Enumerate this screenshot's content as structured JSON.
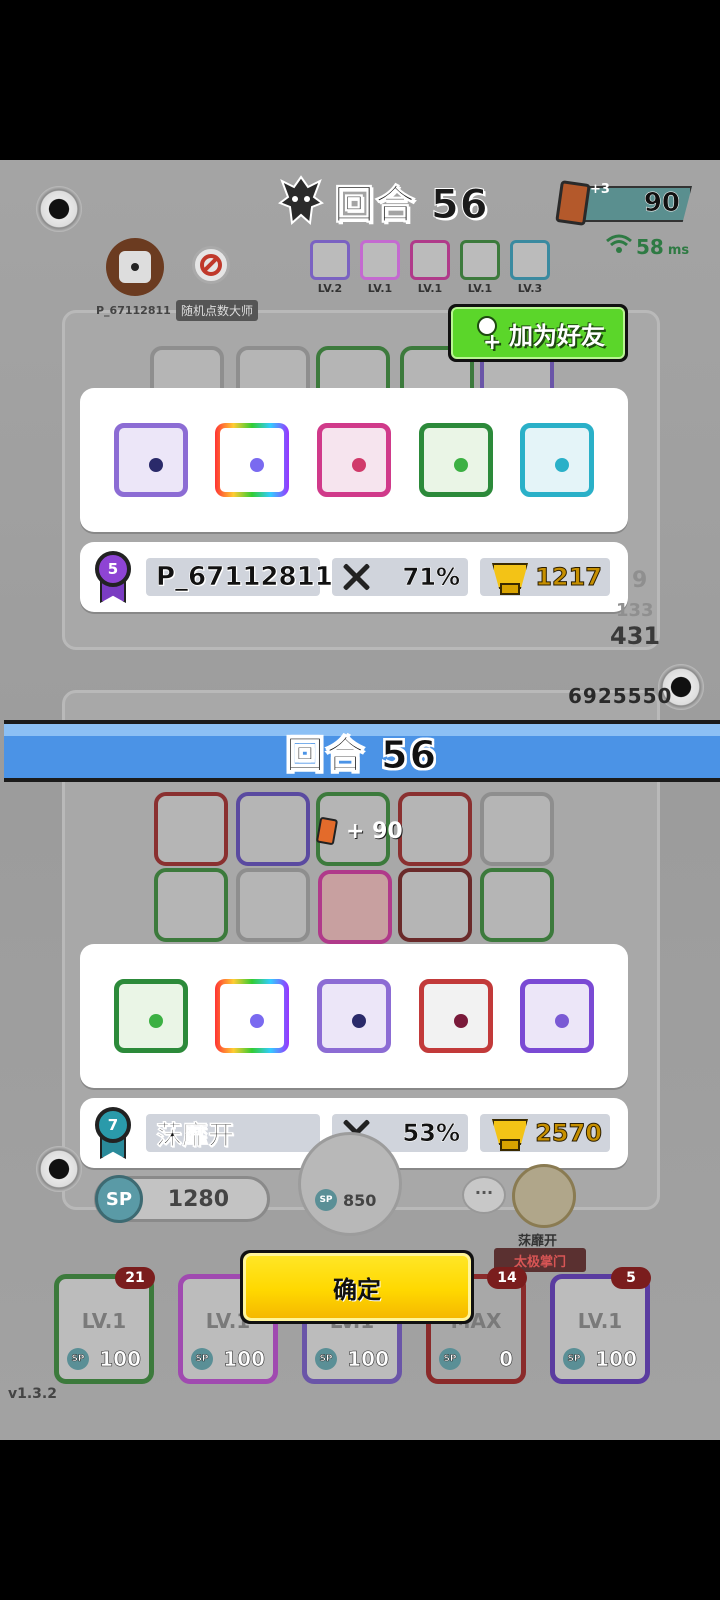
{
  "top_bar": {
    "round_label": "回合 56",
    "cards": {
      "plus": "+3",
      "value": "90"
    },
    "ping": {
      "value": "58",
      "unit": "ms"
    }
  },
  "player_one": {
    "name": "P_67112811",
    "title": "随机点数大师",
    "rank": "5",
    "win_rate": "71%",
    "trophies": "1217",
    "mini_deck_levels": [
      "LV.2",
      "LV.1",
      "LV.1",
      "LV.1",
      "LV.3"
    ],
    "add_friend_label": "加为好友"
  },
  "player_two": {
    "name": "莯靡开",
    "title": "太极掌门",
    "rank": "7",
    "win_rate": "53%",
    "trophies": "2570"
  },
  "opponent_score": "6925550",
  "faint_numbers": [
    "9",
    "133",
    "431"
  ],
  "round_banner": "回合  56",
  "card_gain": "+ 90",
  "sp": {
    "label": "SP",
    "value": "1280",
    "spawn_cost": "850"
  },
  "chat_label": "···",
  "confirm_label": "确定",
  "loadout": [
    {
      "level": "LV.1",
      "cost": "100",
      "count": "21",
      "color": "#3c9c3c"
    },
    {
      "level": "LV.1",
      "cost": "100",
      "count": "",
      "color": "#d44"
    },
    {
      "level": "LV.1",
      "cost": "100",
      "count": "",
      "color": "#7a5bc2"
    },
    {
      "level": "MAX",
      "cost": "0",
      "count": "14",
      "color": "#9a2a2a"
    },
    {
      "level": "LV.1",
      "cost": "100",
      "count": "5",
      "color": "#6a3cc2"
    }
  ],
  "sp_small": "SP",
  "version": "v1.3.2",
  "colors": {
    "accent_green": "#5bd62a",
    "banner_blue": "#4b93e6",
    "confirm_yellow": "#ffd800"
  }
}
